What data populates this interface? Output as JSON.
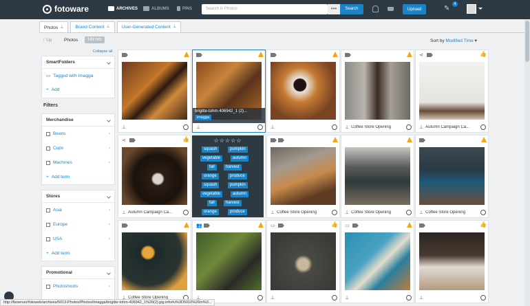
{
  "topbar": {
    "logo": "fotoware",
    "nav": {
      "archives": "ARCHIVES",
      "albums": "ALBUMS",
      "pins": "PINS"
    },
    "search_placeholder": "Search in Photos",
    "search_dots": "•••",
    "search_button": "Search",
    "upload_button": "Upload",
    "notification_count": "4"
  },
  "tabs": [
    {
      "label": "Photos",
      "active": true
    },
    {
      "label": "Brand Content",
      "active": false
    },
    {
      "label": "User-Generated Content",
      "active": false
    }
  ],
  "toolbar": {
    "up": "Up",
    "crumb": "Photos",
    "hits": "148 hits",
    "sort_prefix": "Sort by",
    "sort_value": "Modified Time"
  },
  "sidebar": {
    "collapse_all": "Collapse all",
    "smart_folders": {
      "title": "SmartFolders",
      "items": [
        "Tagged with Imagga"
      ],
      "add": "Add"
    },
    "filters_title": "Filters",
    "merchandise": {
      "title": "Merchandise",
      "items": [
        "Beans",
        "Cups",
        "Machines"
      ],
      "add": "Add term"
    },
    "stores": {
      "title": "Stores",
      "items": [
        "Asia",
        "Europe",
        "USA"
      ],
      "add": "Add term"
    },
    "promotional": {
      "title": "Promotional",
      "items": [
        "Photoshoots"
      ]
    }
  },
  "cards": [
    {
      "label": "",
      "status": "warn"
    },
    {
      "label": "",
      "status": "warn",
      "hover_name": "brigitte-tohm-406942_1 (2)...",
      "hover_kw": "imagga"
    },
    {
      "label": "",
      "status": "warn"
    },
    {
      "label": "Coffee Store Opening",
      "status": "warn"
    },
    {
      "label": "Autumn Campaign Ca...",
      "status": "ok"
    },
    {
      "label": "Autumn Campaign Ca...",
      "status": "ok"
    },
    {
      "label": "",
      "status": "none"
    },
    {
      "label": "Coffee Store Opening",
      "status": "warn"
    },
    {
      "label": "Coffee Store Opening",
      "status": "warn"
    },
    {
      "label": "Coffee Store Opening",
      "status": "warn"
    },
    {
      "label": "Coffee Store Opening",
      "status": "warn"
    },
    {
      "label": "",
      "status": "warn"
    },
    {
      "label": "",
      "status": "ok"
    },
    {
      "label": "",
      "status": "warn"
    },
    {
      "label": "",
      "status": "ok"
    }
  ],
  "overlay": {
    "stars": "☆☆☆☆☆",
    "keywords": [
      "squash",
      "pumpkin",
      "vegetable",
      "autumn",
      "fall",
      "harvest",
      "orange",
      "produce",
      "squash",
      "pumpkin",
      "vegetable",
      "autumn",
      "fall",
      "harvest",
      "orange",
      "produce"
    ]
  },
  "statusbar": "http://fwserver/fotoweb/archives/5013-Photos/Photos/Imagga/brigitte-tohm-406942_1%20(2).jpg.info#u%3D5010%26m%3..."
}
